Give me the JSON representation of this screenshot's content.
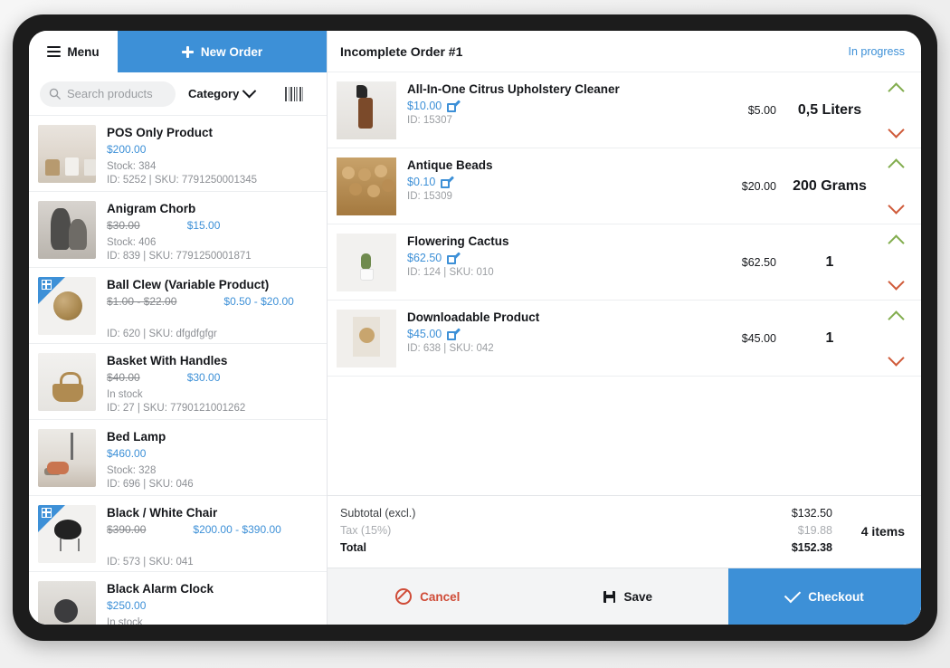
{
  "sidebar": {
    "menu_label": "Menu",
    "new_order_label": "New Order",
    "search_placeholder": "Search products",
    "search_value": "",
    "category_label": "Category",
    "products": [
      {
        "name": "POS Only Product",
        "price": "$200.00",
        "old_price": "",
        "stock": "Stock: 384",
        "meta": "ID: 5252 | SKU: 7791250001345",
        "variable": false,
        "art": "art-pots"
      },
      {
        "name": "Anigram Chorb",
        "price": "$15.00",
        "old_price": "$30.00",
        "stock": "Stock: 406",
        "meta": "ID: 839 | SKU: 7791250001871",
        "variable": false,
        "art": "art-vase"
      },
      {
        "name": "Ball Clew (Variable Product)",
        "price": "$0.50 - $20.00",
        "old_price": "$1.00 - $22.00",
        "stock": "",
        "meta": "ID: 620 | SKU: dfgdfgfgr",
        "variable": true,
        "art": "art-ball"
      },
      {
        "name": "Basket With Handles",
        "price": "$30.00",
        "old_price": "$40.00",
        "stock": "In stock",
        "meta": "ID: 27 | SKU: 7790121001262",
        "variable": false,
        "art": "art-basket"
      },
      {
        "name": "Bed Lamp",
        "price": "$460.00",
        "old_price": "",
        "stock": "Stock: 328",
        "meta": "ID: 696 | SKU: 046",
        "variable": false,
        "art": "art-bed"
      },
      {
        "name": "Black / White Chair",
        "price": "$200.00 - $390.00",
        "old_price": "$390.00",
        "stock": "",
        "meta": "ID: 573 | SKU: 041",
        "variable": true,
        "art": "art-chair"
      },
      {
        "name": "Black Alarm Clock",
        "price": "$250.00",
        "old_price": "",
        "stock": "In stock",
        "meta": "",
        "variable": false,
        "art": "art-clock"
      }
    ]
  },
  "order": {
    "title": "Incomplete Order #1",
    "status": "In progress",
    "items": [
      {
        "name": "All-In-One Citrus Upholstery Cleaner",
        "price": "$10.00",
        "meta": "ID: 15307",
        "line_total": "$5.00",
        "quantity": "0,5 Liters",
        "art": "art-spray"
      },
      {
        "name": "Antique Beads",
        "price": "$0.10",
        "meta": "ID: 15309",
        "line_total": "$20.00",
        "quantity": "200 Grams",
        "art": "art-beads"
      },
      {
        "name": "Flowering Cactus",
        "price": "$62.50",
        "meta": "ID: 124 | SKU: 010",
        "line_total": "$62.50",
        "quantity": "1",
        "art": "art-cactus"
      },
      {
        "name": "Downloadable Product",
        "price": "$45.00",
        "meta": "ID: 638 | SKU: 042",
        "line_total": "$45.00",
        "quantity": "1",
        "art": "art-download"
      }
    ],
    "totals": {
      "subtotal_label": "Subtotal (excl.)",
      "subtotal_value": "$132.50",
      "tax_label": "Tax (15%)",
      "tax_value": "$19.88",
      "total_label": "Total",
      "total_value": "$152.38",
      "items_count": "4 items"
    }
  },
  "footer": {
    "cancel_label": "Cancel",
    "save_label": "Save",
    "checkout_label": "Checkout"
  },
  "colors": {
    "accent": "#3d90d7",
    "danger": "#cf4b37",
    "increment": "#82ad4e",
    "decrement": "#cf5b3a"
  }
}
